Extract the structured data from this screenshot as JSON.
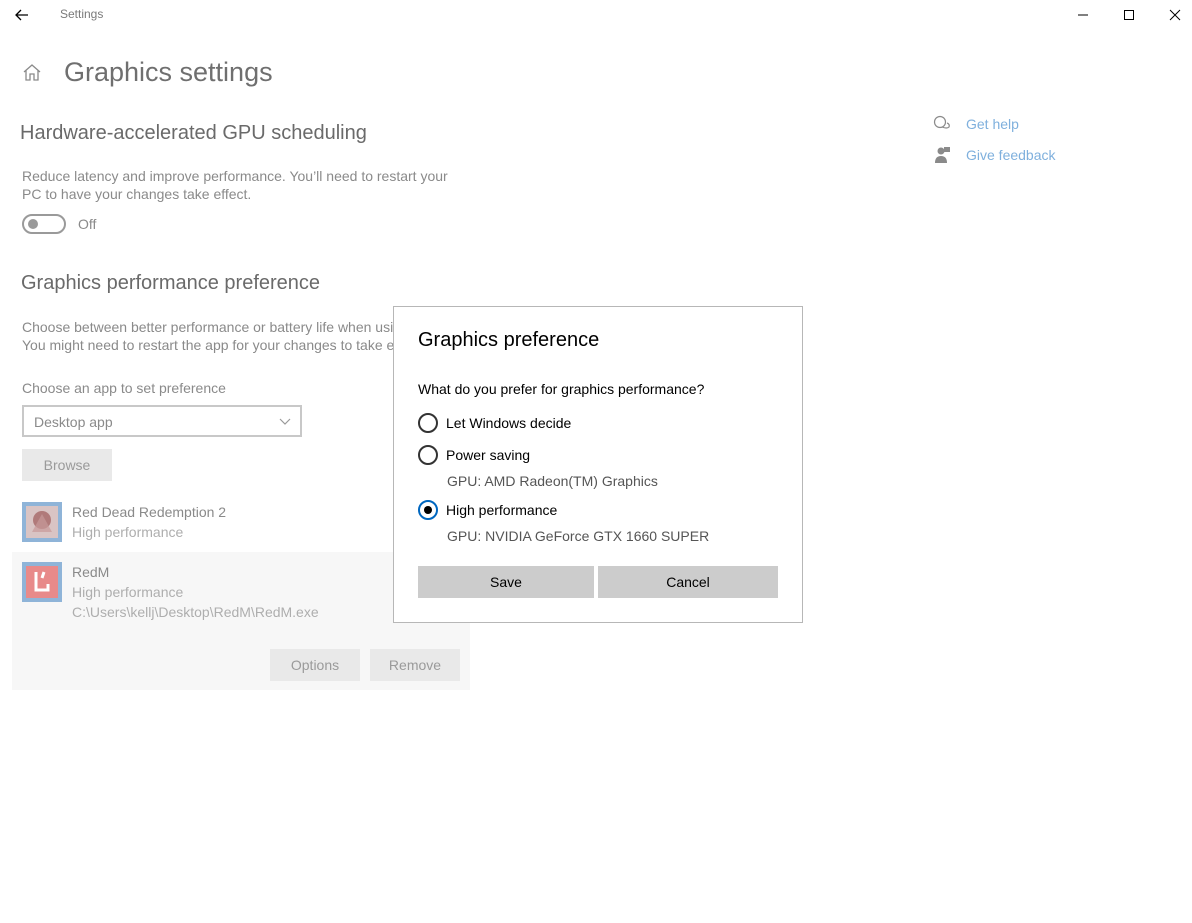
{
  "window": {
    "title": "Settings"
  },
  "page": {
    "title": "Graphics settings"
  },
  "gpu_scheduling": {
    "title": "Hardware-accelerated GPU scheduling",
    "description_line1": "Reduce latency and improve performance. You’ll need to restart your",
    "description_line2": "PC to have your changes take effect.",
    "toggle_state": "Off"
  },
  "performance_pref": {
    "title": "Graphics performance preference",
    "description_line1": "Choose between better performance or battery life when usi",
    "description_line2": "You might need to restart the app for your changes to take e",
    "choose_label": "Choose an app to set preference",
    "app_type_selected": "Desktop app",
    "browse_label": "Browse"
  },
  "apps": [
    {
      "name": "Red Dead Redemption 2",
      "preference": "High performance"
    },
    {
      "name": "RedM",
      "preference": "High performance",
      "path": "C:\\Users\\kellj\\Desktop\\RedM\\RedM.exe",
      "options_label": "Options",
      "remove_label": "Remove"
    }
  ],
  "related": {
    "get_help": "Get help",
    "give_feedback": "Give feedback"
  },
  "dialog": {
    "title": "Graphics preference",
    "question": "What do you prefer for graphics performance?",
    "options": [
      {
        "label": "Let Windows decide",
        "gpu": "",
        "selected": false
      },
      {
        "label": "Power saving",
        "gpu": "GPU: AMD Radeon(TM) Graphics",
        "selected": false
      },
      {
        "label": "High performance",
        "gpu": "GPU: NVIDIA GeForce GTX 1660 SUPER",
        "selected": true
      }
    ],
    "save_label": "Save",
    "cancel_label": "Cancel"
  },
  "colors": {
    "accent": "#0067c0",
    "link": "#7fb0dd",
    "dialog_button": "#cccccc"
  },
  "icons": [
    "back-arrow-icon",
    "minimize-icon",
    "maximize-icon",
    "close-icon",
    "home-icon",
    "chevron-down-icon",
    "help-chat-icon",
    "feedback-icon"
  ]
}
